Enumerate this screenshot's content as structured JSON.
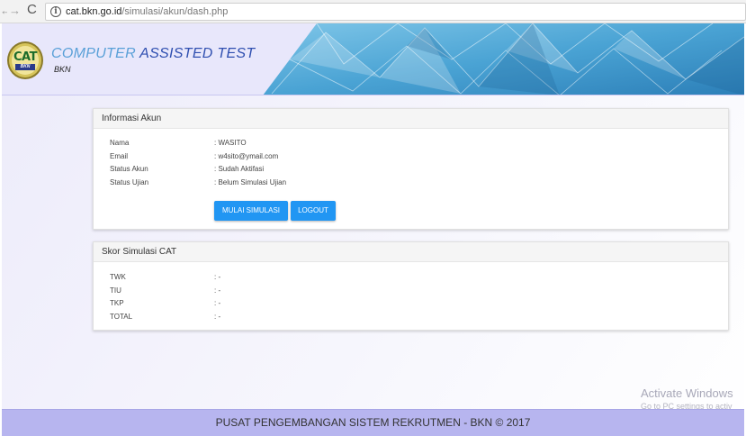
{
  "browser": {
    "back_icon": "back-arrow-icon",
    "forward_icon": "forward-arrow-icon",
    "reload_icon": "reload-icon",
    "url_host": "cat.bkn.go.id",
    "url_path": "/simulasi/akun/dash.php"
  },
  "header": {
    "logo_text": "CAT",
    "logo_sub": "BKN",
    "title_part1": "COMPUTER ",
    "title_part2": "ASSISTED TEST",
    "subtitle": "BKN"
  },
  "account_panel": {
    "title": "Informasi Akun",
    "rows": [
      {
        "label": "Nama",
        "value": ": WASITO"
      },
      {
        "label": "Email",
        "value": ": w4sito@ymail.com"
      },
      {
        "label": "Status Akun",
        "value": ": Sudah Aktifasi"
      },
      {
        "label": "Status Ujian",
        "value": ": Belum Simulasi Ujian"
      }
    ],
    "start_button": "MULAI SIMULASI",
    "logout_button": "LOGOUT"
  },
  "score_panel": {
    "title": "Skor Simulasi CAT",
    "rows": [
      {
        "label": "TWK",
        "value": ": -"
      },
      {
        "label": "TIU",
        "value": ": -"
      },
      {
        "label": "TKP",
        "value": ": -"
      },
      {
        "label": "TOTAL",
        "value": ": -"
      }
    ]
  },
  "watermark": {
    "title": "Activate Windows",
    "subtitle": "Go to PC settings to activ"
  },
  "footer": {
    "text": "PUSAT PENGEMBANGAN SISTEM REKRUTMEN - BKN © 2017"
  },
  "colors": {
    "accent_button": "#2196f3",
    "footer_bg": "#b7b5ef",
    "title_blue": "#2f4fb0"
  }
}
